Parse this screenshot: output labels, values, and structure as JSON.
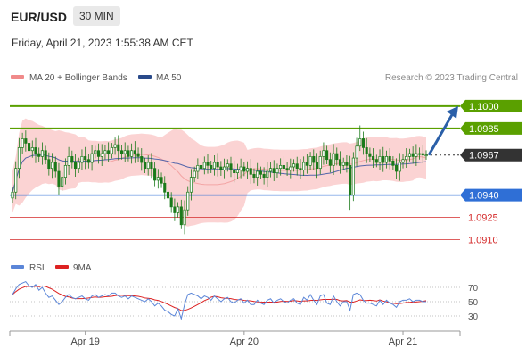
{
  "header": {
    "pair": "EUR/USD",
    "timeframe": "30 MIN",
    "datetime": "Friday, April 21, 2023 1:55:38 AM CET"
  },
  "colors": {
    "bollinger_fill": "#fbd3d3",
    "bollinger_line": "#f3a5a5",
    "ma50": "#5566aa",
    "candle": "#1a7a1a",
    "target_green": "#5aa000",
    "support_blue": "#2f6fd6",
    "pivot_red": "#d42a2a",
    "current_price": "#333333",
    "arrow": "#2a5fa8",
    "rsi": "#5b86d8",
    "rsi_ma": "#dd2222"
  },
  "chart_data": {
    "type": "candlestick",
    "y_range": [
      1.09,
      1.1015
    ],
    "legend": [
      {
        "label": "MA 20 + Bollinger Bands",
        "color": "#f08a8a"
      },
      {
        "label": "MA 50",
        "color": "#2a4a8a"
      }
    ],
    "watermark": "Research © 2023 Trading Central",
    "x_tick_labels": [
      {
        "label": "Apr 19",
        "index": 22
      },
      {
        "label": "Apr 20",
        "index": 70
      },
      {
        "label": "Apr 21",
        "index": 118
      }
    ],
    "levels": [
      {
        "label": "1.1000",
        "value": 1.1,
        "kind": "target"
      },
      {
        "label": "1.0985",
        "value": 1.0985,
        "kind": "target"
      },
      {
        "label": "1.0967",
        "value": 1.0967,
        "kind": "current"
      },
      {
        "label": "1.0940",
        "value": 1.094,
        "kind": "pivot"
      },
      {
        "label": "1.0925",
        "value": 1.0925,
        "kind": "support"
      },
      {
        "label": "1.0910",
        "value": 1.091,
        "kind": "support"
      }
    ],
    "series": [
      {
        "name": "price",
        "close": [
          1.0942,
          1.0958,
          1.0972,
          1.0978,
          1.0975,
          1.097,
          1.0972,
          1.0968,
          1.0966,
          1.097,
          1.0964,
          1.0958,
          1.0962,
          1.0956,
          1.0946,
          1.0952,
          1.096,
          1.0966,
          1.0962,
          1.0958,
          1.0962,
          1.0966,
          1.0964,
          1.0962,
          1.0968,
          1.097,
          1.0966,
          1.0968,
          1.097,
          1.0968,
          1.0972,
          1.0974,
          1.097,
          1.0968,
          1.097,
          1.0966,
          1.097,
          1.0968,
          1.0966,
          1.0962,
          1.0958,
          1.0962,
          1.0958,
          1.095,
          1.0952,
          1.0948,
          1.0942,
          1.0938,
          1.0932,
          1.0928,
          1.0932,
          1.092,
          1.093,
          1.0942,
          1.0952,
          1.0956,
          1.096,
          1.0958,
          1.0962,
          1.096,
          1.0958,
          1.0962,
          1.0959,
          1.0957,
          1.0959,
          1.0961,
          1.0957,
          1.0955,
          1.0957,
          1.0959,
          1.0956,
          1.0958,
          1.0954,
          1.0952,
          1.0956,
          1.0954,
          1.0952,
          1.0956,
          1.0958,
          1.0955,
          1.0958,
          1.096,
          1.0958,
          1.0957,
          1.0959,
          1.0961,
          1.0958,
          1.0957,
          1.0962,
          1.096,
          1.0966,
          1.0962,
          1.0958,
          1.0966,
          1.097,
          1.0964,
          1.096,
          1.0968,
          1.0964,
          1.096,
          1.0962,
          1.096,
          1.094,
          1.0965,
          1.0973,
          1.0978,
          1.0972,
          1.0968,
          1.0966,
          1.0964,
          1.0962,
          1.0966,
          1.0962,
          1.0966,
          1.0963,
          1.096,
          1.0956,
          1.0962,
          1.0964,
          1.0966,
          1.0968,
          1.0966,
          1.0968,
          1.0968,
          1.0967,
          1.0967
        ]
      },
      {
        "name": "MA 20 + Bollinger Bands"
      },
      {
        "name": "MA 50"
      }
    ]
  },
  "rsi_panel": {
    "legend": [
      {
        "label": "RSI",
        "color": "#5b86d8"
      },
      {
        "label": "9MA",
        "color": "#dd2222"
      }
    ],
    "levels": [
      "70",
      "50",
      "30"
    ],
    "range": [
      15,
      85
    ],
    "rsi": [
      60,
      68,
      74,
      76,
      78,
      72,
      70,
      74,
      66,
      70,
      62,
      56,
      58,
      52,
      46,
      50,
      56,
      60,
      56,
      54,
      56,
      58,
      54,
      52,
      58,
      60,
      56,
      58,
      60,
      58,
      62,
      62,
      58,
      56,
      58,
      54,
      58,
      56,
      54,
      52,
      50,
      54,
      50,
      44,
      48,
      44,
      38,
      36,
      32,
      30,
      40,
      26,
      46,
      60,
      62,
      60,
      58,
      54,
      58,
      56,
      52,
      58,
      54,
      50,
      54,
      56,
      50,
      48,
      52,
      54,
      48,
      52,
      46,
      46,
      52,
      48,
      46,
      52,
      54,
      48,
      52,
      54,
      50,
      48,
      52,
      54,
      48,
      46,
      56,
      52,
      60,
      52,
      46,
      58,
      60,
      48,
      46,
      58,
      50,
      44,
      50,
      50,
      38,
      60,
      62,
      60,
      52,
      48,
      48,
      46,
      44,
      52,
      46,
      52,
      48,
      46,
      42,
      50,
      52,
      52,
      54,
      50,
      52,
      52,
      50,
      50
    ]
  },
  "watermark_ticks": [
    "Apr 19",
    "Apr 20",
    "Apr 21"
  ]
}
